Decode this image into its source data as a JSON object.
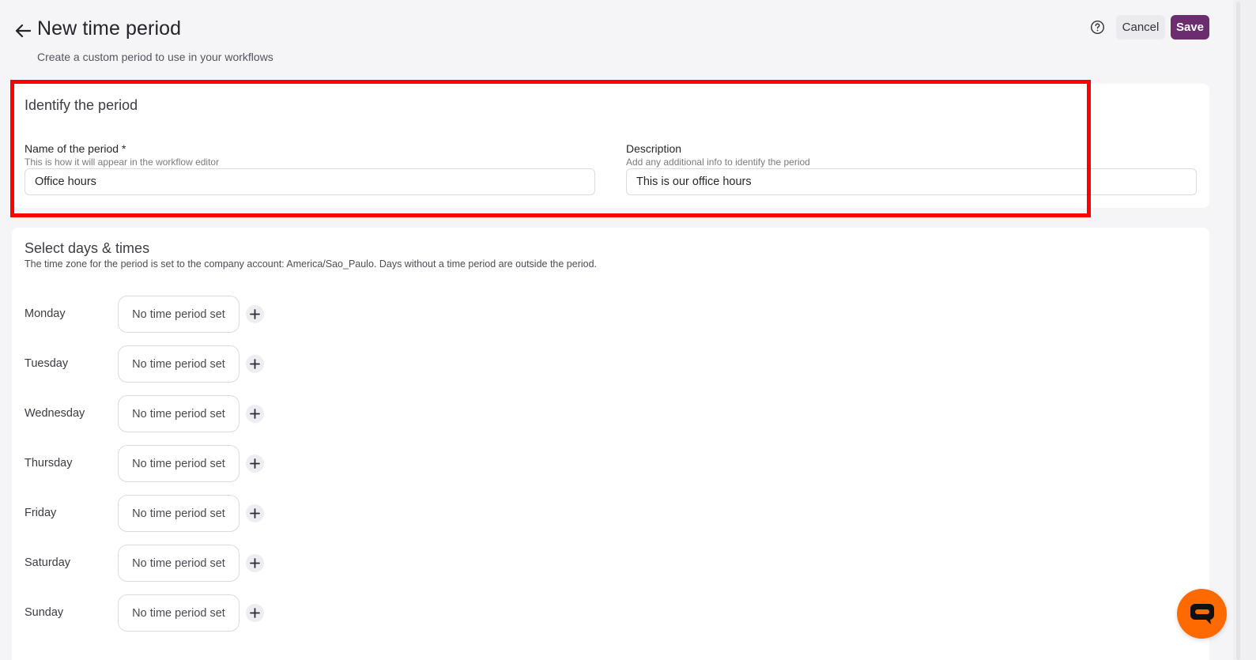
{
  "header": {
    "title": "New time period",
    "subtitle": "Create a custom period to use in your workflows",
    "cancel_label": "Cancel",
    "save_label": "Save",
    "back_icon": "arrow-left-icon",
    "help_icon": "question-circle-icon"
  },
  "identify": {
    "title": "Identify the period",
    "name": {
      "label": "Name of the period *",
      "help": "This is how it will appear in the workflow editor",
      "value": "Office hours"
    },
    "description": {
      "label": "Description",
      "help": "Add any additional info to identify the period",
      "value": "This is our office hours"
    }
  },
  "days": {
    "title": "Select days & times",
    "description": "The time zone for the period is set to the company account: America/Sao_Paulo. Days without a time period are outside the period.",
    "rows": [
      {
        "day": "Monday",
        "period": "No time period set"
      },
      {
        "day": "Tuesday",
        "period": "No time period set"
      },
      {
        "day": "Wednesday",
        "period": "No time period set"
      },
      {
        "day": "Thursday",
        "period": "No time period set"
      },
      {
        "day": "Friday",
        "period": "No time period set"
      },
      {
        "day": "Saturday",
        "period": "No time period set"
      },
      {
        "day": "Sunday",
        "period": "No time period set"
      }
    ]
  },
  "colors": {
    "accent": "#6b2d6f",
    "highlight": "#ff0000",
    "chat": "#ff6a00"
  }
}
